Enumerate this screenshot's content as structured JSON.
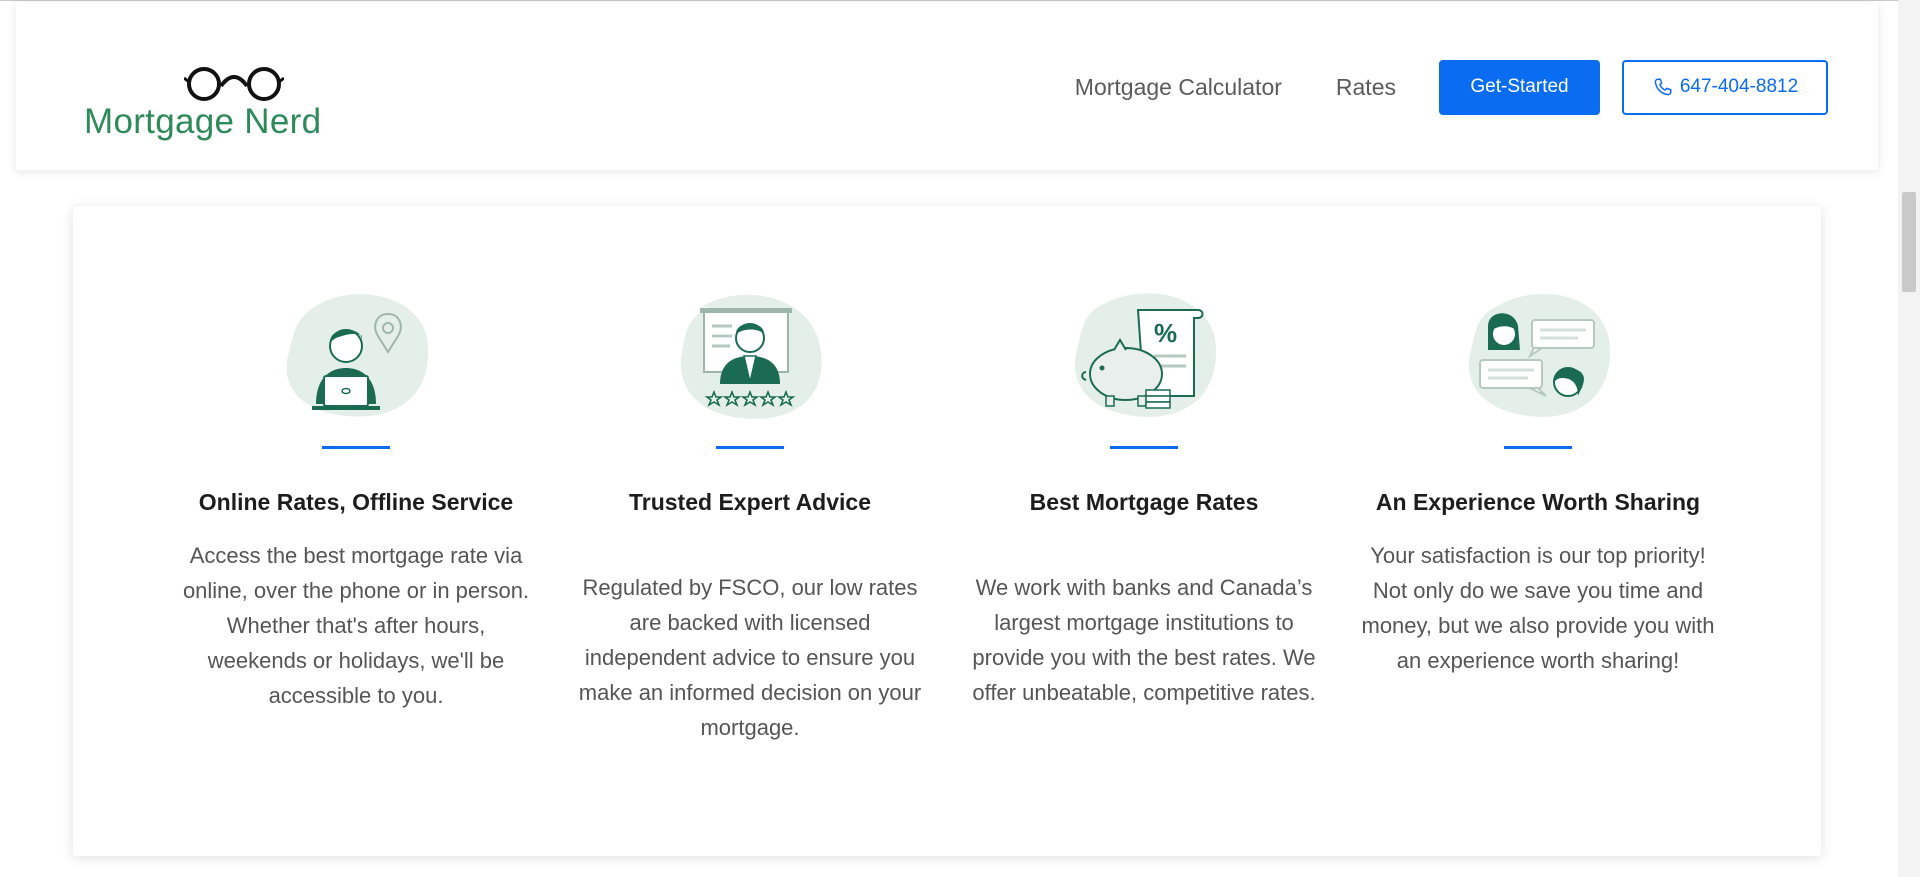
{
  "header": {
    "logo_text": "Mortgage Nerd",
    "nav": {
      "calculator": "Mortgage Calculator",
      "rates": "Rates",
      "get_started": "Get-Started",
      "phone": "647-404-8812"
    }
  },
  "features": [
    {
      "title": "Online Rates, Offline Service",
      "description": "Access the best mortgage rate via online, over the phone or in person. Whether that's after hours, weekends or holidays, we'll be accessible to you."
    },
    {
      "title": "Trusted Expert Advice",
      "description": "Regulated by FSCO, our low rates are backed with licensed independent advice to ensure you make an informed decision on your mortgage."
    },
    {
      "title": "Best Mortgage Rates",
      "description": "We work with banks and Canada’s largest mortgage institutions to provide you with the best rates. We offer unbeatable, competitive rates."
    },
    {
      "title": "An Experience Worth Sharing",
      "description": "Your satisfaction is our top priority! Not only do we save you time and money, but we also provide you with an experience worth sharing!"
    }
  ],
  "colors": {
    "accent": "#0a6cf0",
    "brand_green": "#2f8a59",
    "illustration_green": "#1a6b52",
    "blob": "#e5efe9"
  },
  "icons": [
    "glasses-logo-icon",
    "phone-icon",
    "remote-worker-icon",
    "expert-advisor-icon",
    "piggy-bank-percent-icon",
    "chat-people-icon"
  ]
}
